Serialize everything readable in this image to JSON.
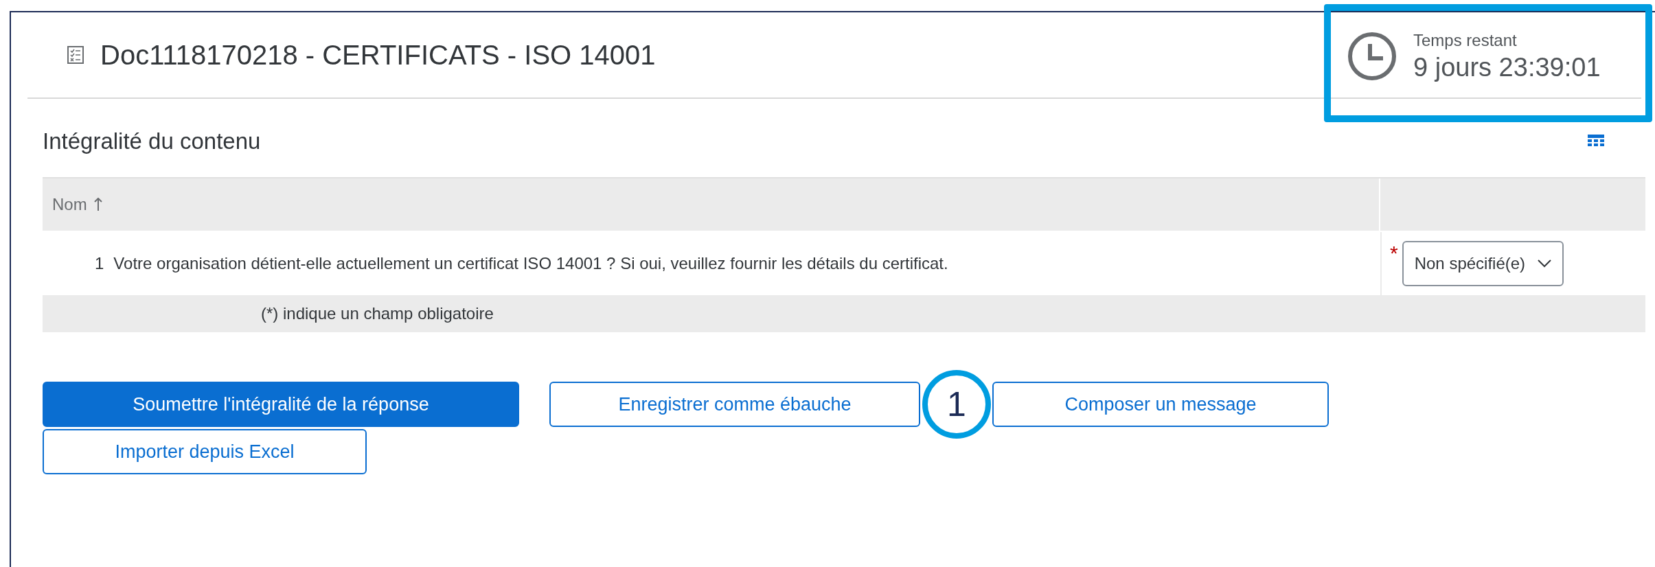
{
  "header": {
    "title": "Doc1118170218 - CERTIFICATS - ISO 14001"
  },
  "timer": {
    "label": "Temps restant",
    "value": "9 jours 23:39:01",
    "highlighted": true
  },
  "section": {
    "title": "Intégralité du contenu"
  },
  "table": {
    "columns": [
      {
        "label": "Nom",
        "sorted": true
      }
    ],
    "rows": [
      {
        "number": "1",
        "question": "Votre organisation détient-elle actuellement un certificat ISO 14001 ? Si oui, veuillez fournir les détails du certificat.",
        "required_mark": "*",
        "answer": "Non spécifié(e)"
      }
    ],
    "footer": "(*) indique un champ obligatoire"
  },
  "buttons": [
    {
      "label": "Soumettre l'intégralité de la réponse",
      "kind": "primary"
    },
    {
      "label": "Enregistrer comme ébauche",
      "kind": "secondary"
    },
    {
      "label": "Composer un message",
      "kind": "secondary"
    },
    {
      "label": "Importer depuis Excel",
      "kind": "secondary"
    }
  ],
  "annotation": {
    "label": "1"
  }
}
